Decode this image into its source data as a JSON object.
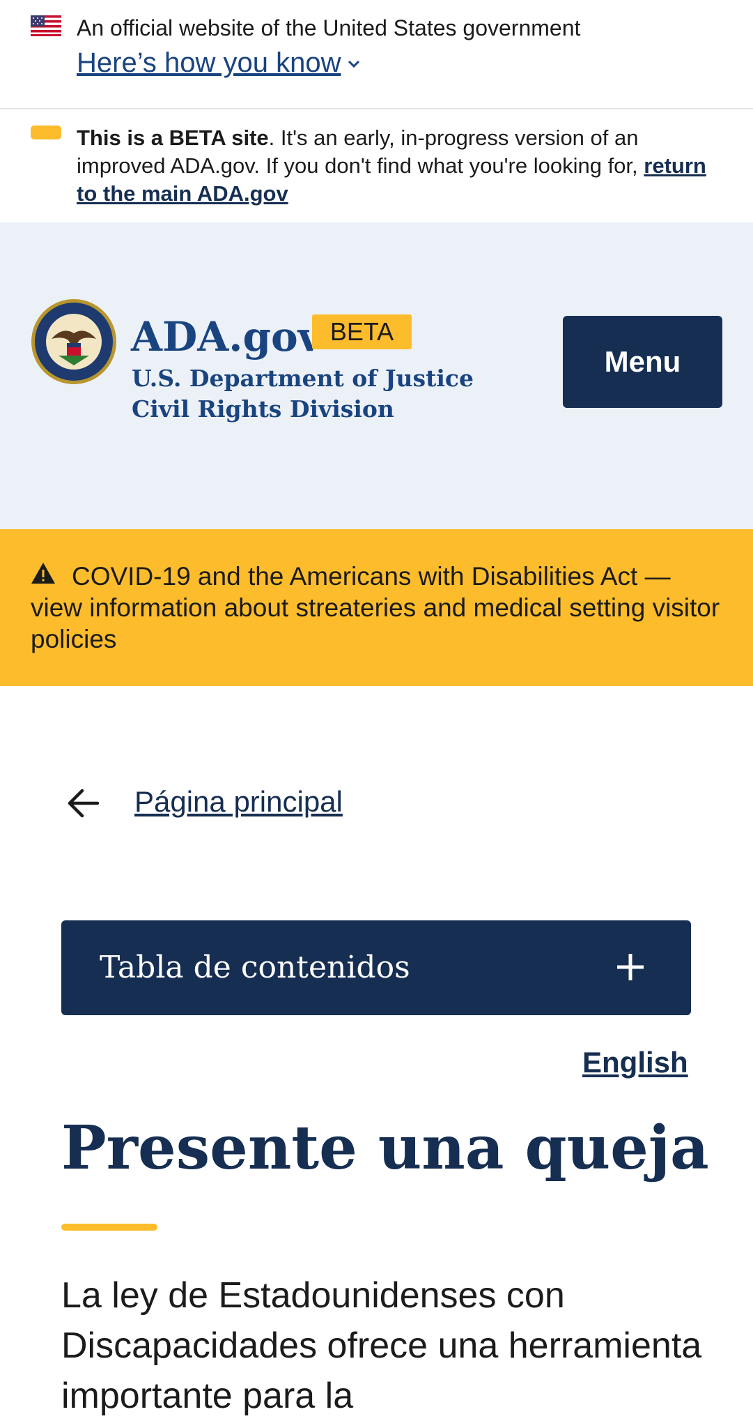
{
  "gov_banner": {
    "official_text": "An official website of the United States government",
    "how_you_know": "Here’s how you know"
  },
  "beta_banner": {
    "bold": "This is a BETA site",
    "text": ". It's an early, in-progress version of an improved ADA.gov. If you don't find what you're looking for, ",
    "link": "return to the main ADA.gov"
  },
  "header": {
    "site_name": "ADA.gov",
    "beta_tag": "BETA",
    "dept_line1": "U.S. Department of Justice",
    "dept_line2": "Civil Rights Division",
    "menu_label": "Menu"
  },
  "alert": {
    "text": "COVID-19 and the Americans with Disabilities Act — view information about streateries and medical setting visitor policies"
  },
  "nav": {
    "back_label": "Página principal"
  },
  "toc": {
    "title": "Tabla de contenidos"
  },
  "language_link": "English",
  "main": {
    "title": "Presente una queja",
    "intro": "La ley de Estadounidenses con Discapacidades ofrece una herramienta importante para la"
  },
  "colors": {
    "navy": "#162e51",
    "blue": "#1a4480",
    "gold": "#fcbc2b",
    "header_bg": "#ecf1f7"
  }
}
